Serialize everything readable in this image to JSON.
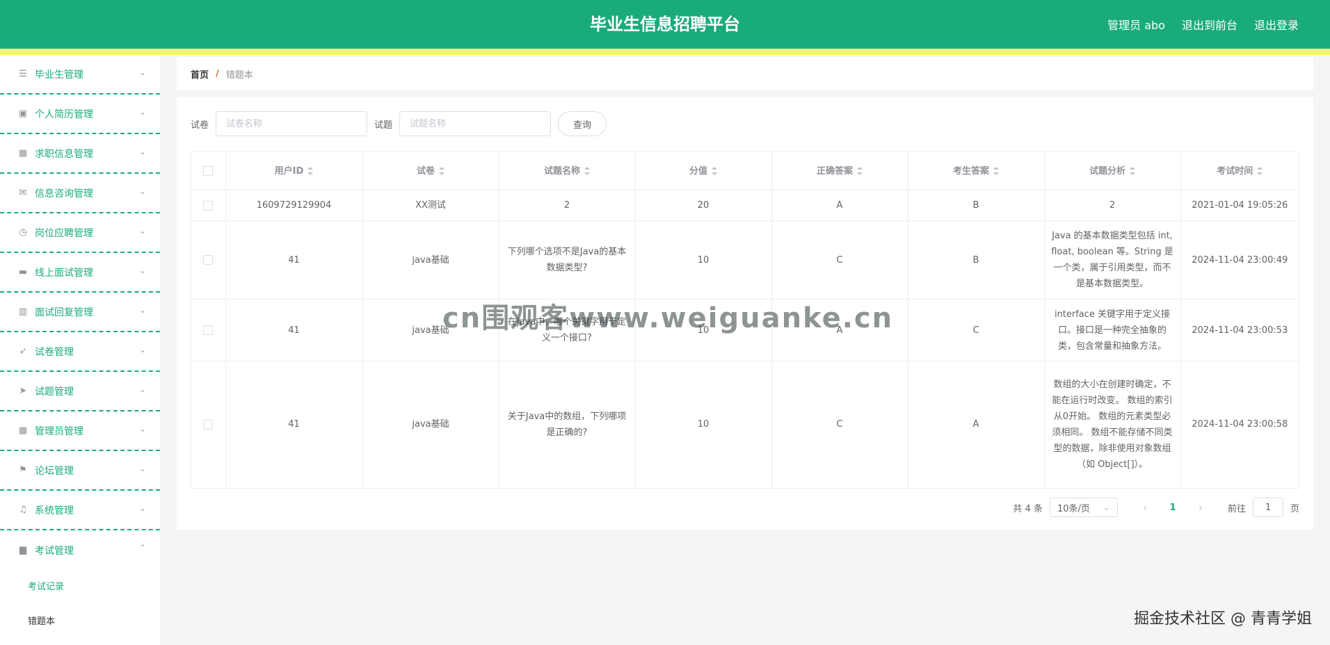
{
  "header": {
    "title": "毕业生信息招聘平台",
    "admin_label": "管理员 abo",
    "front_label": "退出到前台",
    "logout_label": "退出登录"
  },
  "sidebar": {
    "items": [
      {
        "label": "毕业生管理",
        "icon": "sliders-icon"
      },
      {
        "label": "个人简历管理",
        "icon": "clipboard-icon"
      },
      {
        "label": "求职信息管理",
        "icon": "grid-icon"
      },
      {
        "label": "信息咨询管理",
        "icon": "mail-icon"
      },
      {
        "label": "岗位应聘管理",
        "icon": "clock-icon"
      },
      {
        "label": "线上面试管理",
        "icon": "ticket-icon"
      },
      {
        "label": "面试回复管理",
        "icon": "bars-icon"
      },
      {
        "label": "试卷管理",
        "icon": "location-arrow-icon"
      },
      {
        "label": "试题管理",
        "icon": "send-icon"
      },
      {
        "label": "管理员管理",
        "icon": "apps-icon"
      },
      {
        "label": "论坛管理",
        "icon": "flag-icon"
      },
      {
        "label": "系统管理",
        "icon": "microphone-icon"
      },
      {
        "label": "考试管理",
        "icon": "briefcase-icon"
      }
    ],
    "submenu": [
      {
        "label": "考试记录"
      },
      {
        "label": "错题本"
      }
    ]
  },
  "breadcrumb": {
    "home": "首页",
    "separator": "/",
    "current": "错题本"
  },
  "search": {
    "paper_label": "试卷",
    "paper_placeholder": "试卷名称",
    "question_label": "试题",
    "question_placeholder": "试题名称",
    "query_button": "查询"
  },
  "table": {
    "columns": [
      "用户ID",
      "试卷",
      "试题名称",
      "分值",
      "正确答案",
      "考生答案",
      "试题分析",
      "考试时间"
    ],
    "rows": [
      {
        "user_id": "1609729129904",
        "paper": "XX测试",
        "question": "2",
        "score": "20",
        "correct": "A",
        "answer": "B",
        "analysis": "2",
        "time": "2021-01-04 19:05:26"
      },
      {
        "user_id": "41",
        "paper": "java基础",
        "question": "下列哪个选项不是Java的基本数据类型?",
        "score": "10",
        "correct": "C",
        "answer": "B",
        "analysis": "Java 的基本数据类型包括 int, float, boolean 等。String 是一个类，属于引用类型，而不是基本数据类型。",
        "time": "2024-11-04 23:00:49"
      },
      {
        "user_id": "41",
        "paper": "java基础",
        "question": "在Java中，哪个关键字用于定义一个接口?",
        "score": "10",
        "correct": "A",
        "answer": "C",
        "analysis": "interface 关键字用于定义接口。接口是一种完全抽象的类，包含常量和抽象方法。",
        "time": "2024-11-04 23:00:53"
      },
      {
        "user_id": "41",
        "paper": "java基础",
        "question": "关于Java中的数组，下列哪项是正确的?",
        "score": "10",
        "correct": "C",
        "answer": "A",
        "analysis": "数组的大小在创建时确定，不能在运行时改变。 数组的索引从0开始。 数组的元素类型必须相同。 数组不能存储不同类型的数据，除非使用对象数组（如 Object[]）。",
        "time": "2024-11-04 23:00:58"
      }
    ]
  },
  "pagination": {
    "total_text": "共 4 条",
    "page_size": "10条/页",
    "current_page": "1",
    "goto_label": "前往",
    "goto_value": "1",
    "page_suffix": "页"
  },
  "watermarks": {
    "site": "cn围观客www.weiguanke.cn",
    "juejin": "掘金技术社区 @ 青青学姐"
  },
  "colors": {
    "primary": "#1aab7c",
    "header_stripe": "#f0fa6e"
  }
}
